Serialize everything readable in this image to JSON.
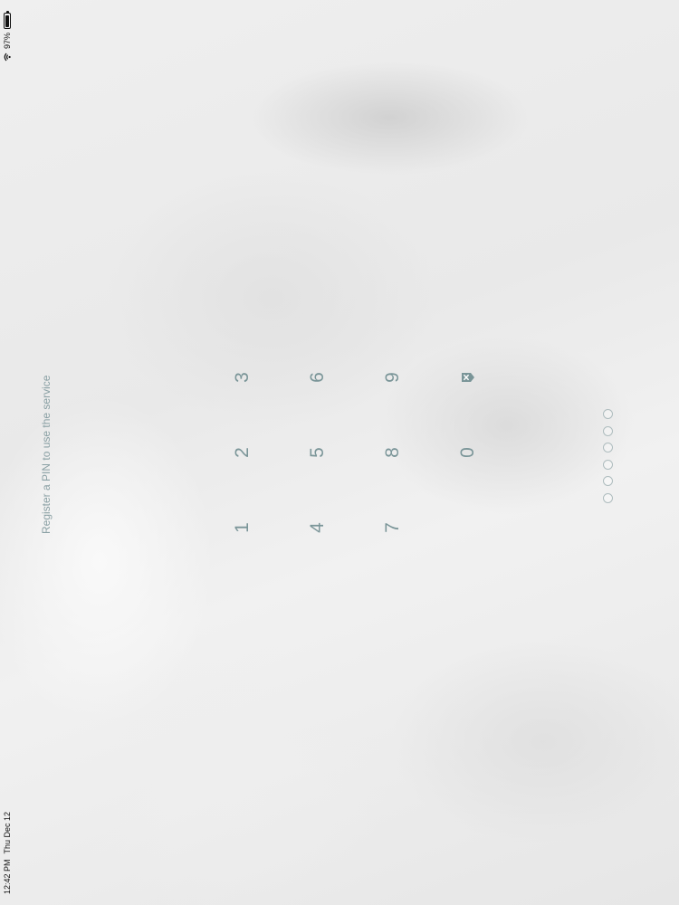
{
  "status_bar": {
    "time": "12:42 PM",
    "date": "Thu Dec 12",
    "battery_percent": "97%",
    "icons": [
      "wifi-icon",
      "battery-icon"
    ]
  },
  "pin": {
    "prompt": "Register a PIN to use the service",
    "digits_entered": 0,
    "digits_total": 6
  },
  "keypad": {
    "k1": "1",
    "k2": "2",
    "k3": "3",
    "k4": "4",
    "k5": "5",
    "k6": "6",
    "k7": "7",
    "k8": "8",
    "k9": "9",
    "k0": "0",
    "delete_icon": "delete-icon"
  },
  "colors": {
    "accent": "#7a9598",
    "prompt": "#8aa0a4"
  }
}
